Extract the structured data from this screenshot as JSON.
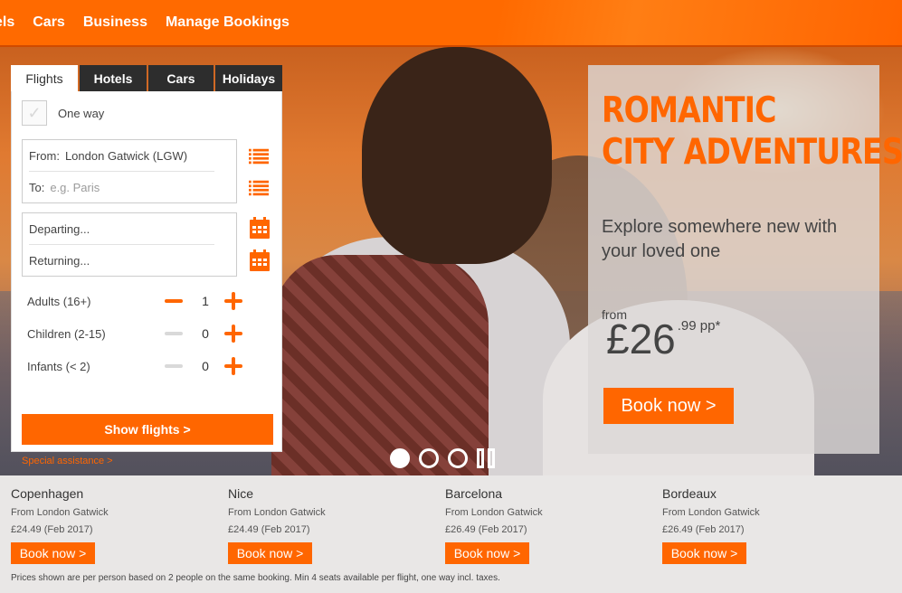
{
  "nav": {
    "items": [
      "els",
      "Cars",
      "Business",
      "Manage Bookings"
    ]
  },
  "widget": {
    "tabs": [
      "Flights",
      "Hotels",
      "Cars",
      "Holidays"
    ],
    "active_tab": "Flights",
    "one_way_label": "One way",
    "one_way_checked": false,
    "from_label": "From:",
    "from_value": "London Gatwick (LGW)",
    "to_label": "To:",
    "to_placeholder": "e.g. Paris",
    "departing_placeholder": "Departing...",
    "returning_placeholder": "Returning...",
    "passengers": [
      {
        "label": "Adults (16+)",
        "count": "1",
        "minus_enabled": true
      },
      {
        "label": "Children (2-15)",
        "count": "0",
        "minus_enabled": false
      },
      {
        "label": "Infants (< 2)",
        "count": "0",
        "minus_enabled": false
      }
    ],
    "show_flights_label": "Show flights >",
    "special_assistance_label": "Special assistance >"
  },
  "promo": {
    "headline_line1": "ROMANTIC",
    "headline_line2": "CITY ADVENTURES",
    "subtitle": "Explore somewhere new with your loved one",
    "from_label": "from",
    "price_main": "£26",
    "price_cents": ".99 pp*",
    "book_label": "Book now >"
  },
  "carousel": {
    "slide_count": 3,
    "active_slide": 1
  },
  "destinations": [
    {
      "name": "Copenhagen",
      "from": "From London Gatwick",
      "price": "£24.49  (Feb 2017)",
      "button": "Book now >"
    },
    {
      "name": "Nice",
      "from": "From London Gatwick",
      "price": "£24.49  (Feb 2017)",
      "button": "Book now >"
    },
    {
      "name": "Barcelona",
      "from": "From London Gatwick",
      "price": "£26.49  (Feb 2017)",
      "button": "Book now >"
    },
    {
      "name": "Bordeaux",
      "from": "From London Gatwick",
      "price": "£26.49  (Feb 2017)",
      "button": "Book now >"
    }
  ],
  "disclaimer": "Prices shown are per person based on 2 people on the same booking. Min 4 seats available per flight, one way incl. taxes.",
  "colors": {
    "brand_orange": "#ff6600",
    "tab_dark": "#2d2d2d"
  },
  "icons": {
    "list": "list-icon",
    "calendar": "calendar-icon",
    "check": "check-icon"
  }
}
